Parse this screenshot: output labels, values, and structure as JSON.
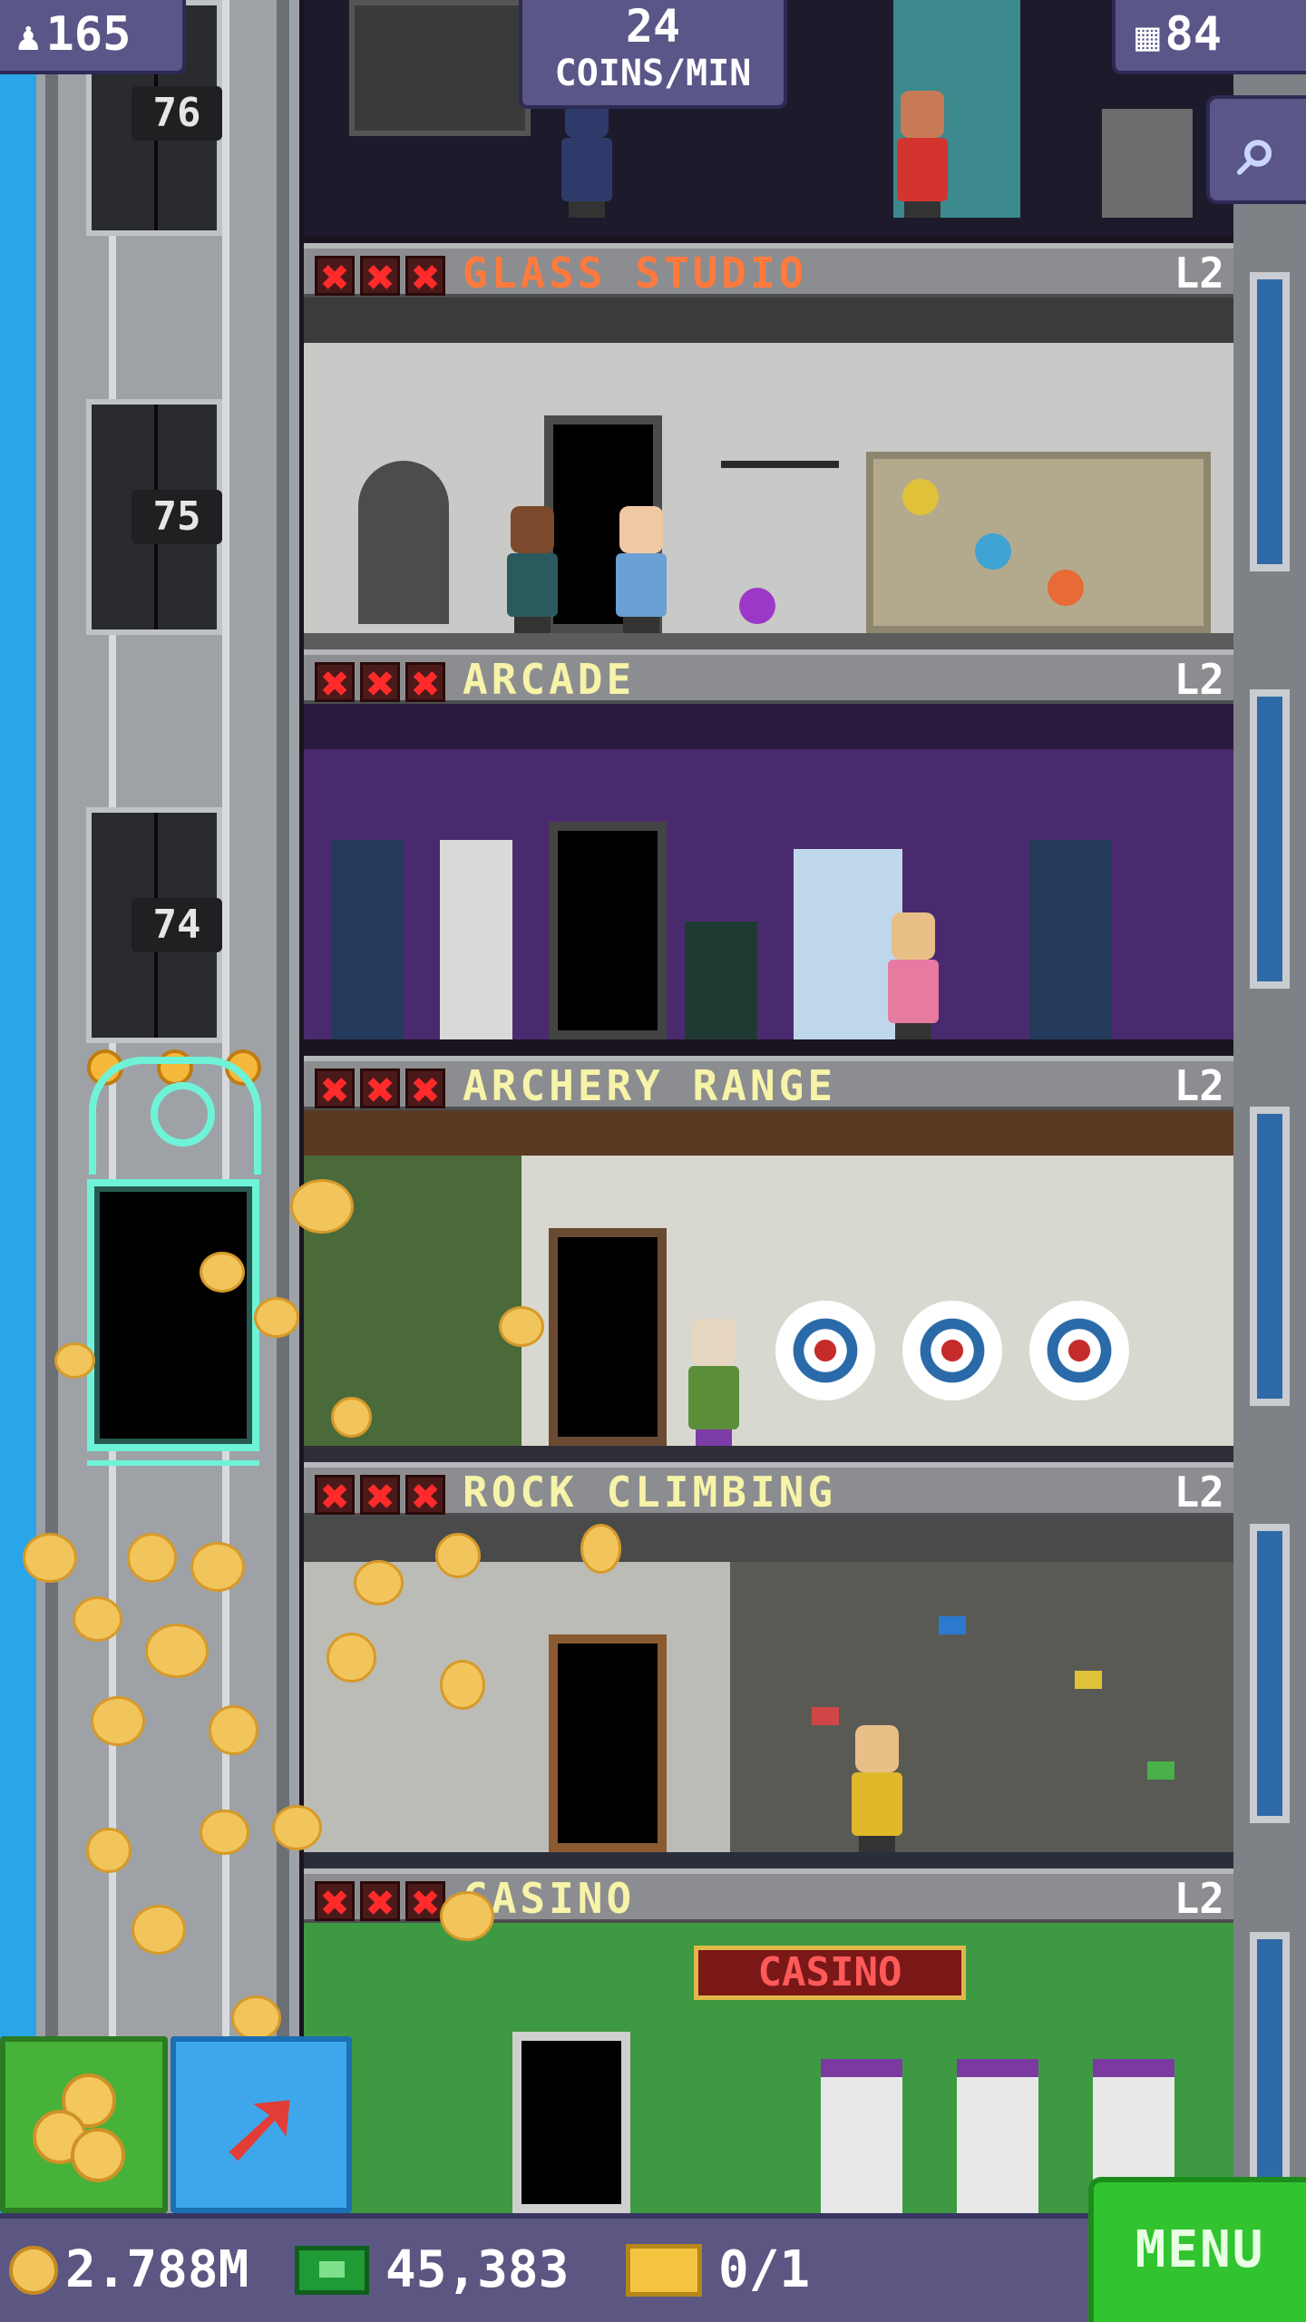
{
  "hud": {
    "population": "165",
    "coins_rate_value": "24",
    "coins_rate_unit": "COINS/MIN",
    "floor_count": "84",
    "population_icon": "person-icon",
    "floors_icon": "building-icon",
    "search_icon": "magnifier-icon"
  },
  "elevator_shaft": {
    "floor_labels": [
      "76",
      "75",
      "74"
    ]
  },
  "floors": [
    {
      "name": "GLASS STUDIO",
      "level": "L2",
      "name_color": "#ff7a3c",
      "stars": [
        "✖",
        "✖",
        "✖"
      ]
    },
    {
      "name": "ARCADE",
      "level": "L2",
      "name_color": "#f7f3a8",
      "stars": [
        "✖",
        "✖",
        "✖"
      ]
    },
    {
      "name": "ARCHERY RANGE",
      "level": "L2",
      "name_color": "#f7f3a8",
      "stars": [
        "✖",
        "✖",
        "✖"
      ]
    },
    {
      "name": "ROCK CLIMBING",
      "level": "L2",
      "name_color": "#f7f3a8",
      "stars": [
        "✖",
        "✖",
        "✖"
      ]
    },
    {
      "name": "CASINO",
      "level": "L2",
      "name_color": "#f7f3a8",
      "stars": [
        "✖",
        "✖",
        "✖"
      ],
      "sign": "CASINO"
    }
  ],
  "buttons": {
    "coins_icon": "coins-icon",
    "elevator_icon": "arrow-up-right-icon",
    "elevator_glyph": "➚",
    "menu": "MENU"
  },
  "bottom_bar": {
    "coins": "2.788M",
    "bux": "45,383",
    "tickets": "0/1"
  },
  "colors": {
    "star_red": "#ff2a2a",
    "elevator_glow": "#6ff3d8",
    "menu_green": "#31c430",
    "hud_purple": "#5a5688"
  }
}
